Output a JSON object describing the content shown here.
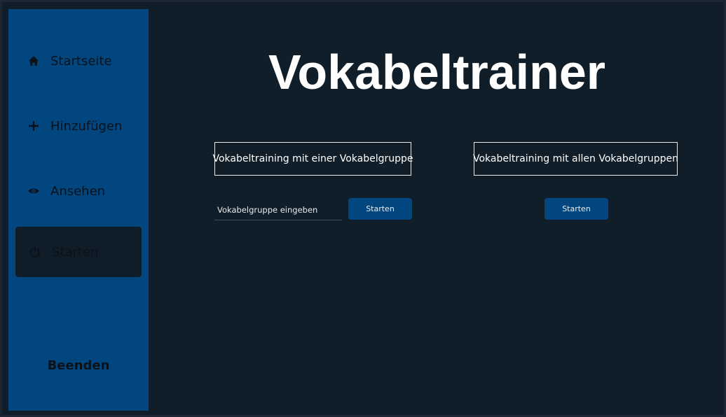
{
  "sidebar": {
    "items": [
      {
        "label": "Startseite",
        "icon": "home-icon"
      },
      {
        "label": "Hinzufügen",
        "icon": "plus-icon"
      },
      {
        "label": "Ansehen",
        "icon": "eye-icon"
      },
      {
        "label": "Starten",
        "icon": "power-icon",
        "active": true
      }
    ],
    "exit_label": "Beenden"
  },
  "main": {
    "title": "Vokabeltrainer",
    "single_group": {
      "heading": "Vokabeltraining mit einer Vokabelgruppe",
      "input_placeholder": "Vokabelgruppe eingeben",
      "input_value": "",
      "button_label": "Starten"
    },
    "all_groups": {
      "heading": "Vokabeltraining mit allen Vokabelgruppen",
      "button_label": "Starten"
    }
  },
  "colors": {
    "background": "#101e2a",
    "sidebar": "#02467f",
    "button": "#02467f",
    "text": "#ffffff"
  }
}
